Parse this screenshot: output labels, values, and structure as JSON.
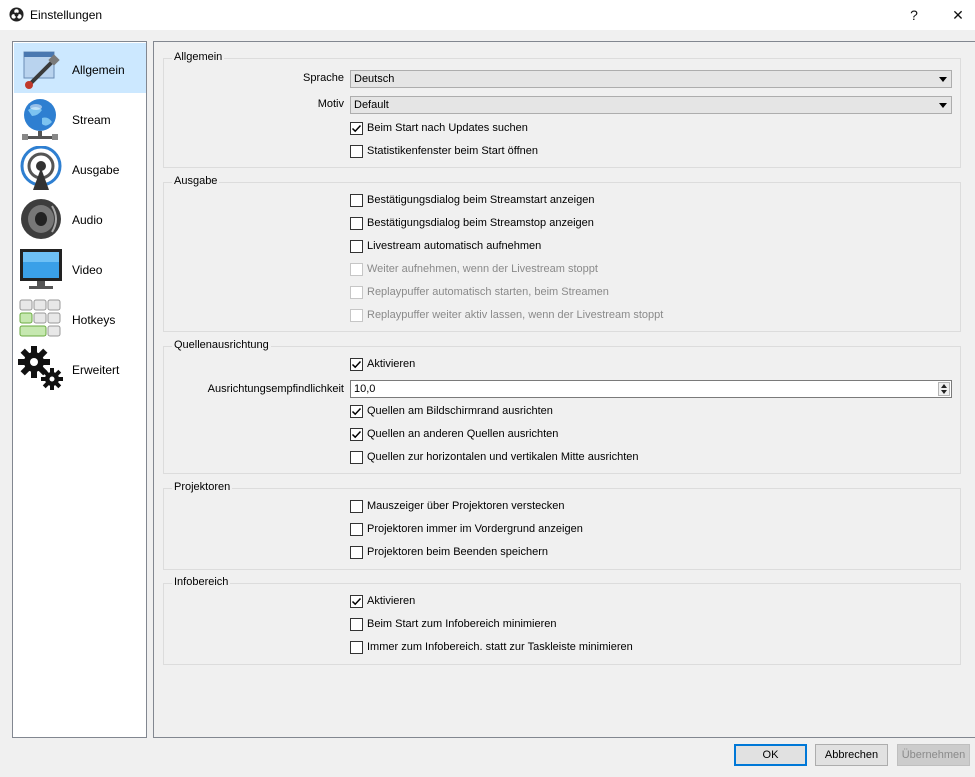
{
  "window": {
    "title": "Einstellungen",
    "help_glyph": "?",
    "close_glyph": "✕"
  },
  "sidebar": {
    "items": [
      {
        "label": "Allgemein",
        "icon": "general-settings-icon",
        "selected": true
      },
      {
        "label": "Stream",
        "icon": "globe-network-icon"
      },
      {
        "label": "Ausgabe",
        "icon": "broadcast-antenna-icon"
      },
      {
        "label": "Audio",
        "icon": "speaker-icon"
      },
      {
        "label": "Video",
        "icon": "monitor-icon"
      },
      {
        "label": "Hotkeys",
        "icon": "keyboard-icon"
      },
      {
        "label": "Erweitert",
        "icon": "gears-icon"
      }
    ]
  },
  "general": {
    "title": "Allgemein",
    "language_label": "Sprache",
    "language_value": "Deutsch",
    "theme_label": "Motiv",
    "theme_value": "Default",
    "checks": [
      {
        "label": "Beim Start nach Updates suchen",
        "checked": true
      },
      {
        "label": "Statistikenfenster beim Start öffnen",
        "checked": false
      }
    ]
  },
  "output": {
    "title": "Ausgabe",
    "checks": [
      {
        "label": "Bestätigungsdialog beim Streamstart anzeigen",
        "checked": false
      },
      {
        "label": "Bestätigungsdialog beim Streamstop anzeigen",
        "checked": false
      },
      {
        "label": "Livestream automatisch aufnehmen",
        "checked": false
      },
      {
        "label": "Weiter aufnehmen, wenn der Livestream stoppt",
        "checked": false,
        "disabled": true
      },
      {
        "label": "Replaypuffer automatisch starten, beim Streamen",
        "checked": false,
        "disabled": true
      },
      {
        "label": "Replaypuffer weiter aktiv lassen, wenn der Livestream stoppt",
        "checked": false,
        "disabled": true
      }
    ]
  },
  "snapping": {
    "title": "Quellenausrichtung",
    "enable": {
      "label": "Aktivieren",
      "checked": true
    },
    "sensitivity_label": "Ausrichtungsempfindlichkeit",
    "sensitivity_value": "10,0",
    "checks": [
      {
        "label": "Quellen am Bildschirmrand ausrichten",
        "checked": true
      },
      {
        "label": "Quellen an anderen Quellen ausrichten",
        "checked": true
      },
      {
        "label": "Quellen zur horizontalen und vertikalen Mitte ausrichten",
        "checked": false
      }
    ]
  },
  "projectors": {
    "title": "Projektoren",
    "checks": [
      {
        "label": "Mauszeiger über Projektoren verstecken",
        "checked": false
      },
      {
        "label": "Projektoren immer im Vordergrund anzeigen",
        "checked": false
      },
      {
        "label": "Projektoren beim Beenden speichern",
        "checked": false
      }
    ]
  },
  "tray": {
    "title": "Infobereich",
    "checks": [
      {
        "label": "Aktivieren",
        "checked": true
      },
      {
        "label": "Beim Start zum Infobereich minimieren",
        "checked": false
      },
      {
        "label": "Immer zum Infobereich. statt zur Taskleiste minimieren",
        "checked": false
      }
    ]
  },
  "buttons": {
    "ok": "OK",
    "cancel": "Abbrechen",
    "apply": "Übernehmen"
  }
}
